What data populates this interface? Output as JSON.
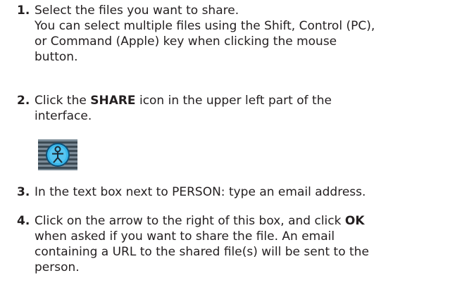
{
  "steps": [
    {
      "number": "1.",
      "lines": [
        "Select the files you want to share.",
        "You can select multiple files using the Shift, Control (PC),",
        "or Command (Apple) key when clicking the mouse",
        "button."
      ]
    },
    {
      "number": "2.",
      "line1_prefix": "Click the ",
      "line1_bold": "SHARE",
      "line1_suffix": " icon in the upper left part of the",
      "line2": "interface.",
      "icon": "share-person-icon"
    },
    {
      "number": "3.",
      "lines": [
        "In the text box next to PERSON: type an email address."
      ]
    },
    {
      "number": "4.",
      "line1_prefix": "Click on the arrow to the right of this box, and click ",
      "line1_bold": "OK",
      "lines_rest": [
        "when asked if you want to share the file. An email",
        "containing a URL to the shared file(s) will be sent to the",
        "person."
      ]
    }
  ]
}
